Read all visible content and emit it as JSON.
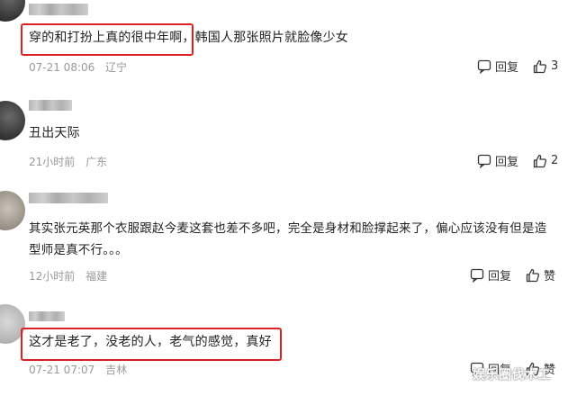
{
  "comments": [
    {
      "text": "穿的和打扮上真的很中年啊，韩国人那张照片就脸像少女",
      "time": "07-21 08:06",
      "location": "辽宁",
      "reply_label": "回复",
      "likes": "3"
    },
    {
      "text": "丑出天际",
      "time": "21小时前",
      "location": "广东",
      "reply_label": "回复",
      "likes": "2"
    },
    {
      "text_line1": "其实张元英那个衣服跟赵今麦这套也差不多吧，完全是身材和脸撑起来了，偏心应该没有但是造",
      "text_line2": "型师是真不行。。。",
      "time": "12小时前",
      "location": "福建",
      "reply_label": "回复",
      "like_label": "赞"
    },
    {
      "text": "这才是老了，没老的人，老气的感觉，真好",
      "time": "07-21 07:07",
      "location": "吉林",
      "reply_label": "回复",
      "like_label": "赞"
    }
  ],
  "watermark": "娱乐圈伐木工",
  "colors": {
    "highlight": "#e02020",
    "meta": "#9a9a9a"
  }
}
